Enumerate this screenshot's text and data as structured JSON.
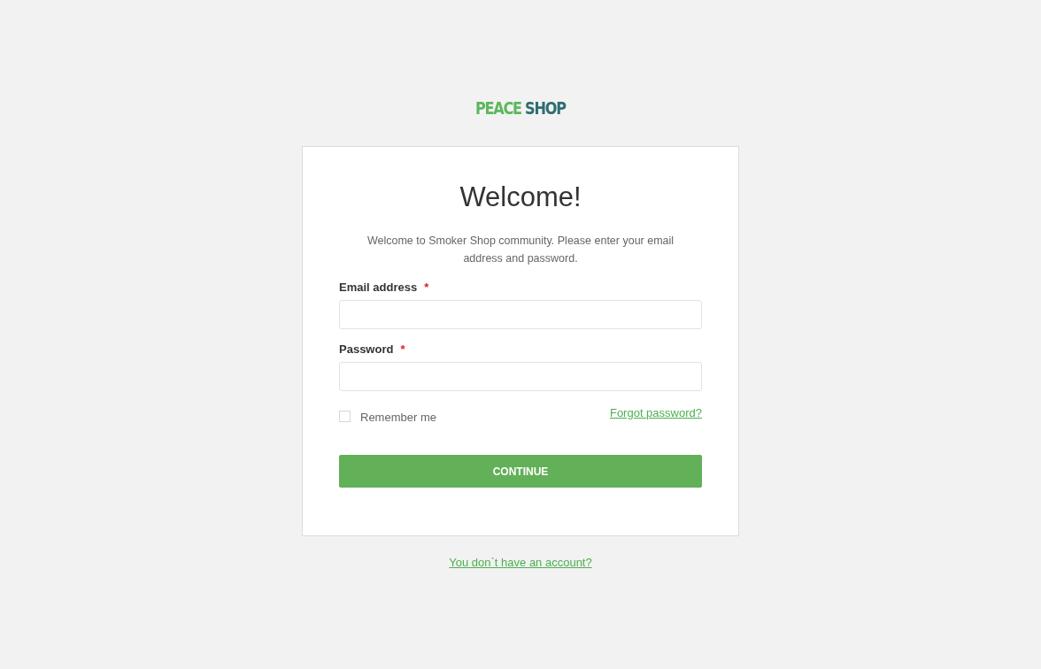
{
  "logo": {
    "parts": [
      {
        "text": "PEACE",
        "color": "#5cb85c"
      },
      {
        "text": "SHOP",
        "color": "#2e6e72"
      }
    ]
  },
  "title": "Welcome!",
  "intro": "Welcome to Smoker Shop community. Please enter your email address and password.",
  "required_mark": "*",
  "fields": [
    {
      "label": "Email address",
      "required": true
    },
    {
      "label": "Password",
      "required": true
    }
  ],
  "remember": {
    "label": "Remember me",
    "checked": false
  },
  "forgot_link": "Forgot password?",
  "submit": "CONTINUE",
  "signup_link": "You don`t have an account?"
}
